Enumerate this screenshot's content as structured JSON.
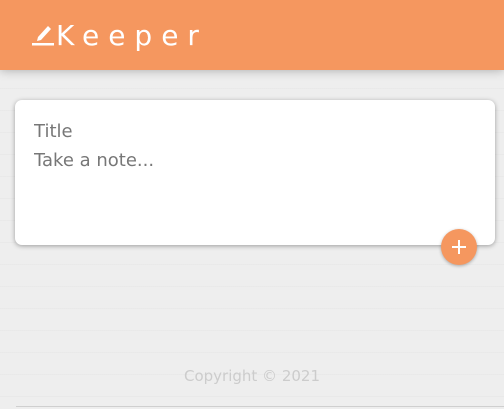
{
  "header": {
    "title": "Keeper",
    "logo_icon": "pencil-icon",
    "background_color": "#f5975f"
  },
  "note_form": {
    "title_placeholder": "Title",
    "content_placeholder": "Take a note...",
    "add_button_icon": "plus-icon",
    "add_button_color": "#f5975f"
  },
  "footer": {
    "text": "Copyright © 2021"
  }
}
